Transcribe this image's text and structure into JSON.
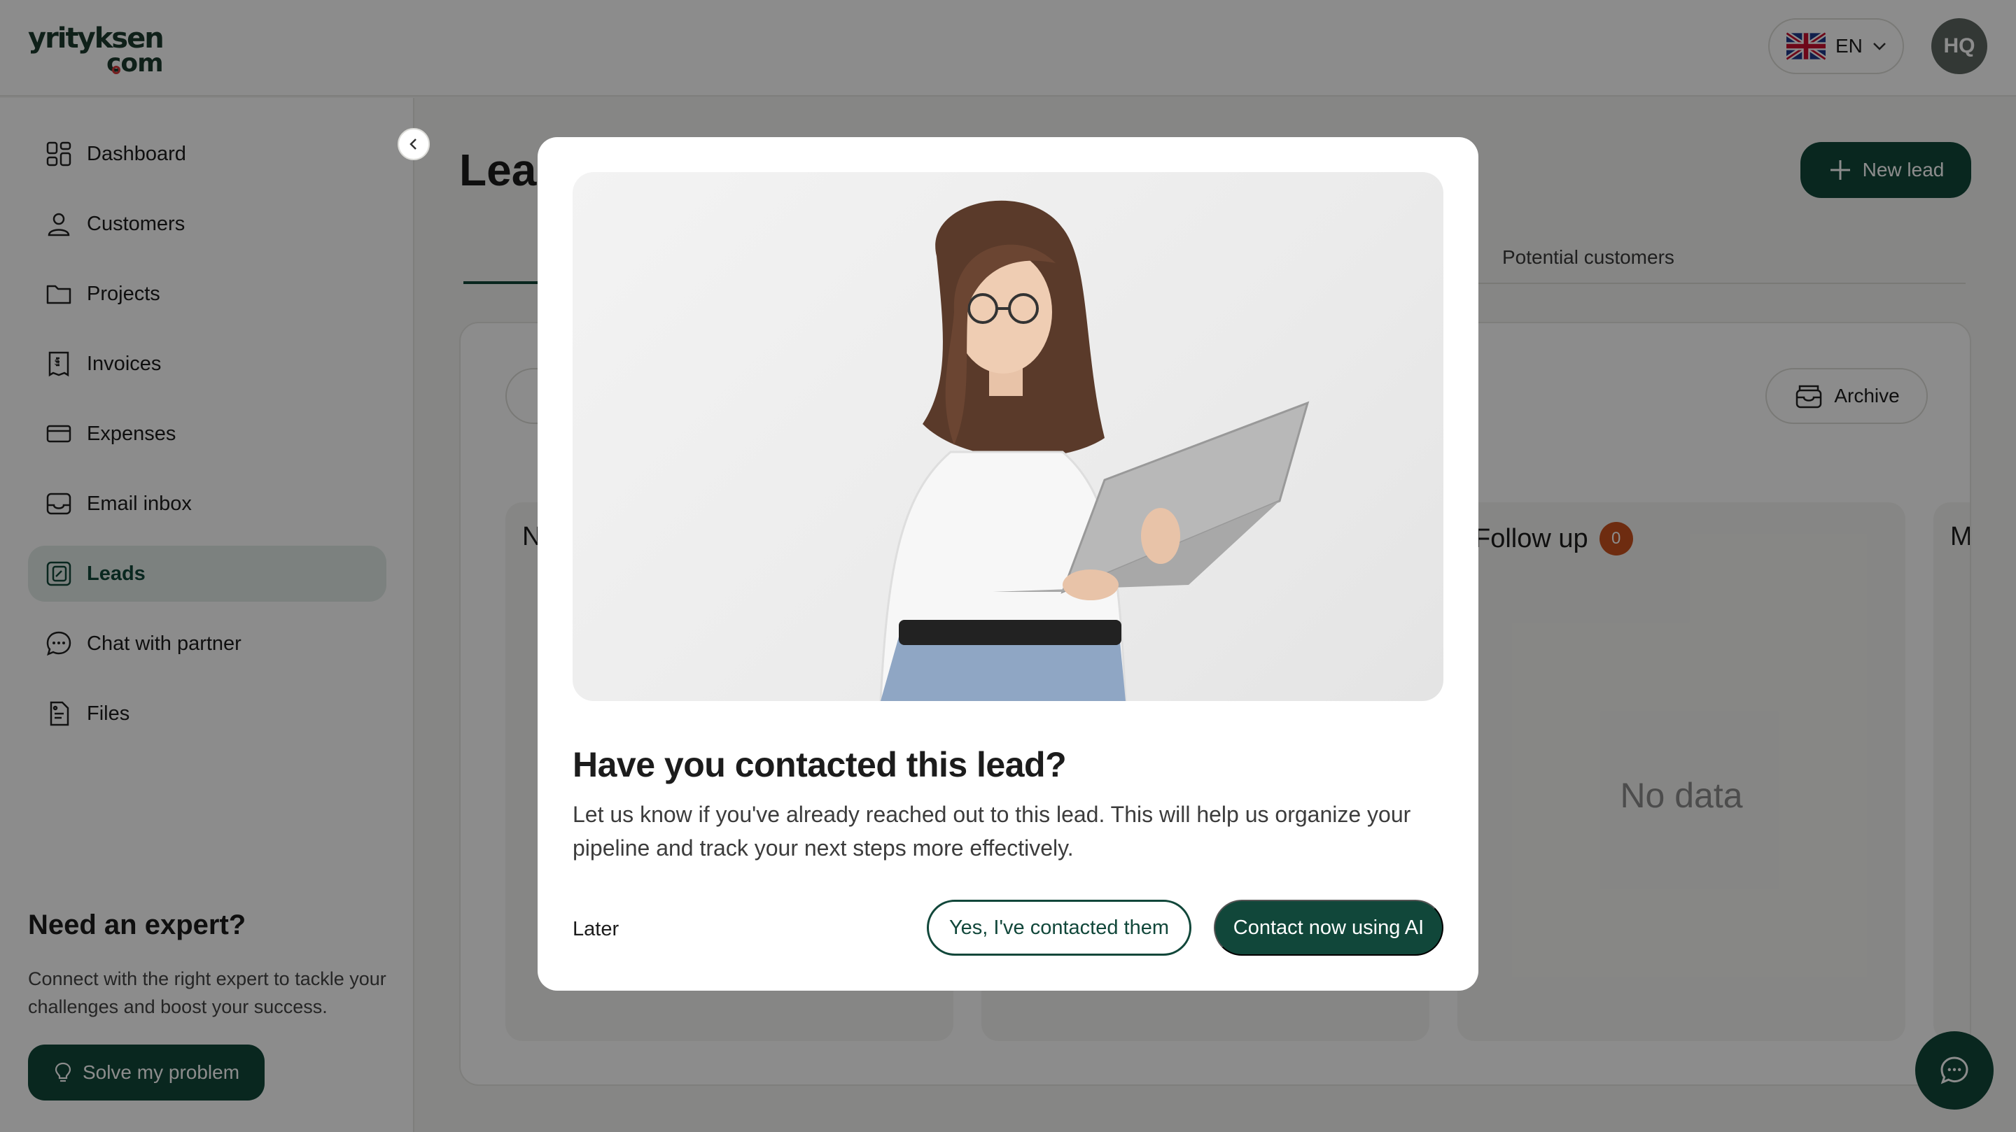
{
  "header": {
    "logo_line1": "yrityksen",
    "logo_line2": "com",
    "language": "EN",
    "avatar_initials": "HQ"
  },
  "sidebar": {
    "items": [
      {
        "label": "Dashboard",
        "icon": "dashboard-icon"
      },
      {
        "label": "Customers",
        "icon": "user-icon"
      },
      {
        "label": "Projects",
        "icon": "folder-icon"
      },
      {
        "label": "Invoices",
        "icon": "invoice-icon"
      },
      {
        "label": "Expenses",
        "icon": "card-icon"
      },
      {
        "label": "Email inbox",
        "icon": "inbox-icon"
      },
      {
        "label": "Leads",
        "icon": "leads-icon",
        "active": true
      },
      {
        "label": "Chat with partner",
        "icon": "chat-icon"
      },
      {
        "label": "Files",
        "icon": "files-icon"
      }
    ],
    "expert": {
      "title": "Need an expert?",
      "text": "Connect with the right expert to tackle your challenges and boost your success.",
      "button": "Solve my problem"
    }
  },
  "main": {
    "title": "Lea",
    "new_lead_button": "New lead",
    "tab_potential": "Potential customers",
    "archive_button": "Archive",
    "columns": [
      {
        "title": "N",
        "count": ""
      },
      {
        "title": "",
        "count": ""
      },
      {
        "title": "Follow up",
        "count": "0",
        "empty_text": "No data"
      },
      {
        "title": "M",
        "count": ""
      }
    ]
  },
  "modal": {
    "title": "Have you contacted this lead?",
    "body": "Let us know if you've already reached out to this lead. This will help us organize your pipeline and track your next steps more effectively.",
    "later_button": "Later",
    "yes_button": "Yes, I've contacted them",
    "ai_button": "Contact now using AI"
  },
  "colors": {
    "brand_green": "#11473a",
    "badge_orange": "#c8501e",
    "overlay": "rgba(0,0,0,0.45)"
  }
}
